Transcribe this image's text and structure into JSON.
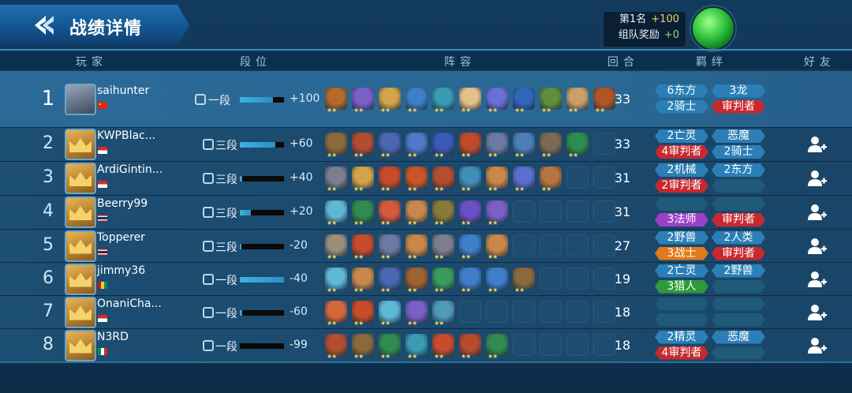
{
  "header": {
    "title": "战绩详情",
    "reward_rank_label": "第1名",
    "reward_rank_value": "+100",
    "reward_team_label": "组队奖励",
    "reward_team_value": "+0"
  },
  "columns": [
    "玩家",
    "段位",
    "阵容",
    "回合",
    "羁绊",
    "好友"
  ],
  "colors": {
    "synergy_blue": "#2b7fb6",
    "synergy_red": "#c8292f",
    "synergy_purple": "#9b3fc8",
    "synergy_orange": "#e07a1c",
    "synergy_green": "#2f9a3a"
  },
  "players": [
    {
      "rank": "1",
      "name": "saihunter",
      "flag": "china",
      "tier": "一段",
      "tier_fill": 0.75,
      "points": "+100",
      "rounds": "33",
      "friend": false,
      "units": [
        "#b36a2a",
        "#7b5fc5",
        "#d4a44a",
        "#3f7fc9",
        "#3a9bb5",
        "#e3c189",
        "#6a6fd6",
        "#2f66b9",
        "#5f8f3b",
        "#caa06a",
        "#b05528"
      ],
      "synergies": [
        {
          "label": "6东方",
          "color": "blue"
        },
        {
          "label": "3龙",
          "color": "blue"
        },
        {
          "label": "2骑士",
          "color": "blue"
        },
        {
          "label": "审判者",
          "color": "red"
        }
      ]
    },
    {
      "rank": "2",
      "name": "KWPBlac...",
      "flag": "indonesia",
      "tier": "三段",
      "tier_fill": 0.8,
      "points": "+60",
      "rounds": "33",
      "friend": true,
      "units": [
        "#8c6a3c",
        "#b44c32",
        "#4a67b5",
        "#4f78c7",
        "#3a59b8",
        "#bf4b2d",
        "#6c7aa1",
        "#4d7fb8",
        "#7d6a55",
        "#2f8c4f",
        null
      ],
      "synergies": [
        {
          "label": "2亡灵",
          "color": "blue"
        },
        {
          "label": "恶魔",
          "color": "blue"
        },
        {
          "label": "4审判者",
          "color": "red"
        },
        {
          "label": "2骑士",
          "color": "blue"
        }
      ]
    },
    {
      "rank": "3",
      "name": "ArdiGintin...",
      "flag": "indonesia",
      "tier": "三段",
      "tier_fill": 0.05,
      "points": "+40",
      "rounds": "31",
      "friend": true,
      "units": [
        "#7d7f8f",
        "#d4a44a",
        "#c94b2a",
        "#cc5528",
        "#b34e2e",
        "#3f8fb8",
        "#c9884a",
        "#5b6fd0",
        "#b8763f",
        null,
        null
      ],
      "synergies": [
        {
          "label": "2机械",
          "color": "blue"
        },
        {
          "label": "2东方",
          "color": "blue"
        },
        {
          "label": "2审判者",
          "color": "red"
        },
        {
          "label": "",
          "color": "empty"
        }
      ]
    },
    {
      "rank": "4",
      "name": "Beerry99",
      "flag": "thailand",
      "tier": "三段",
      "tier_fill": 0.25,
      "points": "+20",
      "rounds": "31",
      "friend": true,
      "units": [
        "#5fb7d6",
        "#2f8c4f",
        "#d45a3a",
        "#c9884a",
        "#8a7a3a",
        "#6a4fc5",
        "#7b5fc5",
        null,
        null,
        null,
        null
      ],
      "synergies": [
        {
          "label": "",
          "color": "empty"
        },
        {
          "label": "",
          "color": "empty"
        },
        {
          "label": "3法师",
          "color": "purple"
        },
        {
          "label": "审判者",
          "color": "red"
        }
      ]
    },
    {
      "rank": "5",
      "name": "Topperer",
      "flag": "thailand",
      "tier": "三段",
      "tier_fill": 0.03,
      "points": "-20",
      "rounds": "27",
      "friend": true,
      "units": [
        "#9a8f7a",
        "#c94b2a",
        "#6c7aa1",
        "#c9884a",
        "#7d7f8f",
        "#3f7fc9",
        "#c9884a",
        null,
        null,
        null,
        null
      ],
      "synergies": [
        {
          "label": "2野兽",
          "color": "blue"
        },
        {
          "label": "2人类",
          "color": "blue"
        },
        {
          "label": "3战士",
          "color": "orange"
        },
        {
          "label": "审判者",
          "color": "red"
        }
      ]
    },
    {
      "rank": "6",
      "name": "jimmy36",
      "flag": "guinea",
      "tier": "一段",
      "tier_fill": 1.0,
      "points": "-40",
      "rounds": "19",
      "friend": true,
      "units": [
        "#5fb7d6",
        "#c9884a",
        "#4a67b5",
        "#a0622f",
        "#3a9b5a",
        "#3f7fc9",
        "#3f7fc9",
        "#8a6a3a",
        null,
        null,
        null
      ],
      "synergies": [
        {
          "label": "2亡灵",
          "color": "blue"
        },
        {
          "label": "2野兽",
          "color": "blue"
        },
        {
          "label": "3猎人",
          "color": "green"
        },
        {
          "label": "",
          "color": "empty"
        }
      ]
    },
    {
      "rank": "7",
      "name": "OnaniCha...",
      "flag": "indonesia",
      "tier": "一段",
      "tier_fill": 0.05,
      "points": "-60",
      "rounds": "18",
      "friend": true,
      "units": [
        "#d4683a",
        "#c94b2a",
        "#5fb7d6",
        "#7b5fc5",
        "#4f9ab8",
        null,
        null,
        null,
        null,
        null,
        null
      ],
      "synergies": [
        {
          "label": "",
          "color": "empty"
        },
        {
          "label": "",
          "color": "empty"
        },
        {
          "label": "",
          "color": "empty"
        },
        {
          "label": "",
          "color": "empty"
        }
      ]
    },
    {
      "rank": "8",
      "name": "N3RD",
      "flag": "italy",
      "tier": "一段",
      "tier_fill": 0.0,
      "points": "-99",
      "rounds": "18",
      "friend": true,
      "units": [
        "#b34e2e",
        "#8a6a3a",
        "#2f8c4f",
        "#3a9bb5",
        "#c94b2a",
        "#b84a2e",
        "#2f8c4f",
        null,
        null,
        null,
        null
      ],
      "synergies": [
        {
          "label": "2精灵",
          "color": "blue"
        },
        {
          "label": "恶魔",
          "color": "blue"
        },
        {
          "label": "4审判者",
          "color": "red"
        },
        {
          "label": "",
          "color": "empty"
        }
      ]
    }
  ]
}
